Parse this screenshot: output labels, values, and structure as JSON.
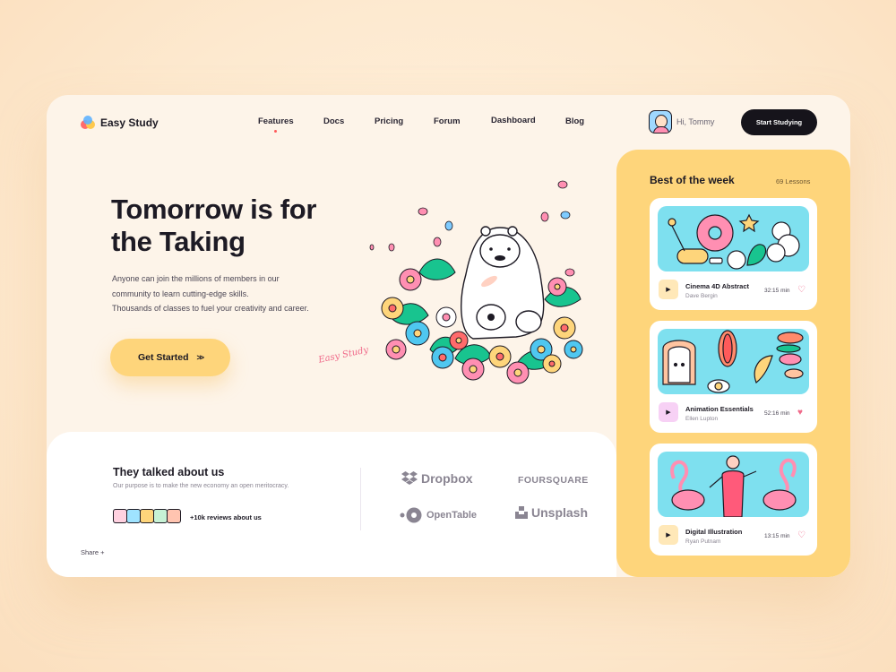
{
  "app": {
    "name": "Easy Study"
  },
  "nav": {
    "items": [
      "Features",
      "Docs",
      "Pricing",
      "Forum",
      "Dashboard",
      "Blog"
    ],
    "active": "Features"
  },
  "user": {
    "greeting": "Hi, Tommy"
  },
  "header": {
    "cta": "Start Studying"
  },
  "hero": {
    "title": "Tomorrow is for the Taking",
    "description_lines": [
      "Anyone can join the millions of members in our",
      "community to learn cutting-edge skills.",
      "Thousands of classes to fuel your creativity and career."
    ],
    "cta": "Get Started",
    "signature": "Easy Study"
  },
  "testimonials": {
    "title": "They talked about us",
    "subtitle": "Our purpose is to make the new economy an open meritocracy.",
    "reviews": "+10k reviews about us",
    "share": "Share +"
  },
  "brands": [
    "Dropbox",
    "FOURSQUARE",
    "OpenTable",
    "Unsplash"
  ],
  "best_of_week": {
    "title": "Best of the week",
    "count": "69 Lessons",
    "lessons": [
      {
        "title": "Cinema 4D Abstract",
        "author": "Dave Bergin",
        "duration": "32:15 min",
        "liked": false
      },
      {
        "title": "Animation Essentials",
        "author": "Ellen Lupton",
        "duration": "52:16 min",
        "liked": true
      },
      {
        "title": "Digital Illustration",
        "author": "Ryan Putnam",
        "duration": "13:15 min",
        "liked": false
      }
    ]
  },
  "colors": {
    "accent_yellow": "#fed57b",
    "dark": "#16141b",
    "pink": "#f06a8a",
    "thumb_cyan": "#7ee0ef"
  }
}
